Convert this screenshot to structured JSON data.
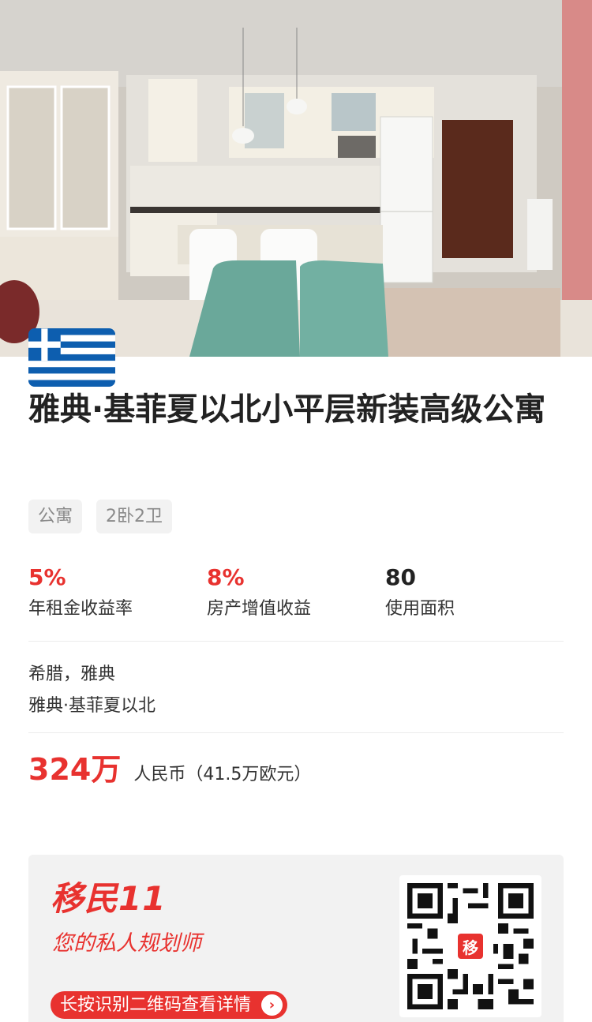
{
  "listing": {
    "title": "雅典·基菲夏以北小平层新装高级公寓",
    "tags": [
      "公寓",
      "2卧2卫"
    ],
    "stats": [
      {
        "value": "5%",
        "label": "年租金收益率"
      },
      {
        "value": "8%",
        "label": "房产增值收益"
      },
      {
        "value": "80",
        "label": "使用面积"
      }
    ],
    "location": {
      "region": "希腊，雅典",
      "district": "雅典·基菲夏以北"
    },
    "price": {
      "amount": "324万",
      "detail": "人民币（41.5万欧元）"
    }
  },
  "promo": {
    "brand": "移民11",
    "slogan": "您的私人规划师",
    "cta_label": "长按识别二维码查看详情",
    "qr_badge": "移"
  },
  "icons": {
    "flag": "greece-flag-icon",
    "arrow": "chevron-right-icon",
    "qr": "qr-code-icon"
  },
  "colors": {
    "accent": "#e8322f",
    "tag_bg": "#f2f2f2",
    "promo_bg": "#f2f2f2",
    "flag_blue": "#0d5eaf"
  }
}
